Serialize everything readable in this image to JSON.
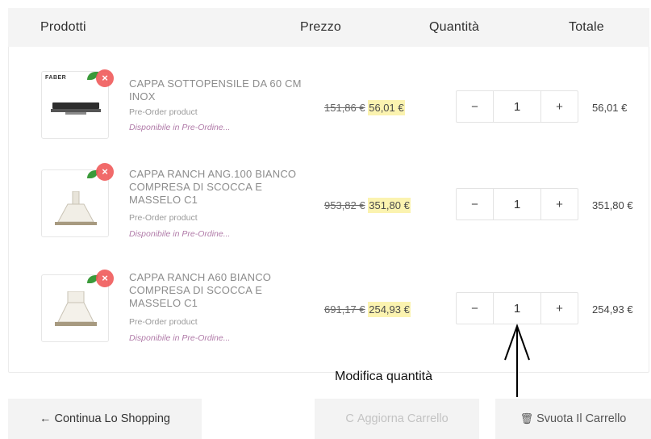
{
  "table_header": {
    "products": "Prodotti",
    "price": "Prezzo",
    "quantity": "Quantità",
    "total": "Totale"
  },
  "items": [
    {
      "brand": "FABER",
      "name": "CAPPA SOTTOPENSILE DA 60 CM INOX",
      "preorder": "Pre-Order product",
      "availability": "Disponibile in Pre-Ordine...",
      "old_price": "151,86 €",
      "new_price": "56,01 €",
      "quantity": "1",
      "line_total": "56,01 €",
      "minus": "−",
      "plus": "+",
      "remove": "×"
    },
    {
      "brand": "",
      "name": "CAPPA RANCH ANG.100 BIANCO COMPRESA DI SCOCCA E MASSELO C1",
      "preorder": "Pre-Order product",
      "availability": "Disponibile in Pre-Ordine...",
      "old_price": "953,82 €",
      "new_price": "351,80 €",
      "quantity": "1",
      "line_total": "351,80 €",
      "minus": "−",
      "plus": "+",
      "remove": "×"
    },
    {
      "brand": "",
      "name": "CAPPA RANCH A60 BIANCO COMPRESA DI SCOCCA E MASSELO C1",
      "preorder": "Pre-Order product",
      "availability": "Disponibile in Pre-Ordine...",
      "old_price": "691,17 €",
      "new_price": "254,93 €",
      "quantity": "1",
      "line_total": "254,93 €",
      "minus": "−",
      "plus": "+",
      "remove": "×"
    }
  ],
  "annotation": {
    "label": "Modifica quantità"
  },
  "buttons": {
    "continue": "Continua Lo Shopping",
    "continue_icon": "←",
    "update": "Aggiorna Carrello",
    "update_icon": "C",
    "empty": "Svuota Il Carrello",
    "empty_icon": "🗑"
  },
  "colors": {
    "header_bg": "#f4f4f4",
    "price_highlight": "#fbf3b0",
    "remove_red": "#f05a5a",
    "availability_purple": "#b07aa8"
  }
}
